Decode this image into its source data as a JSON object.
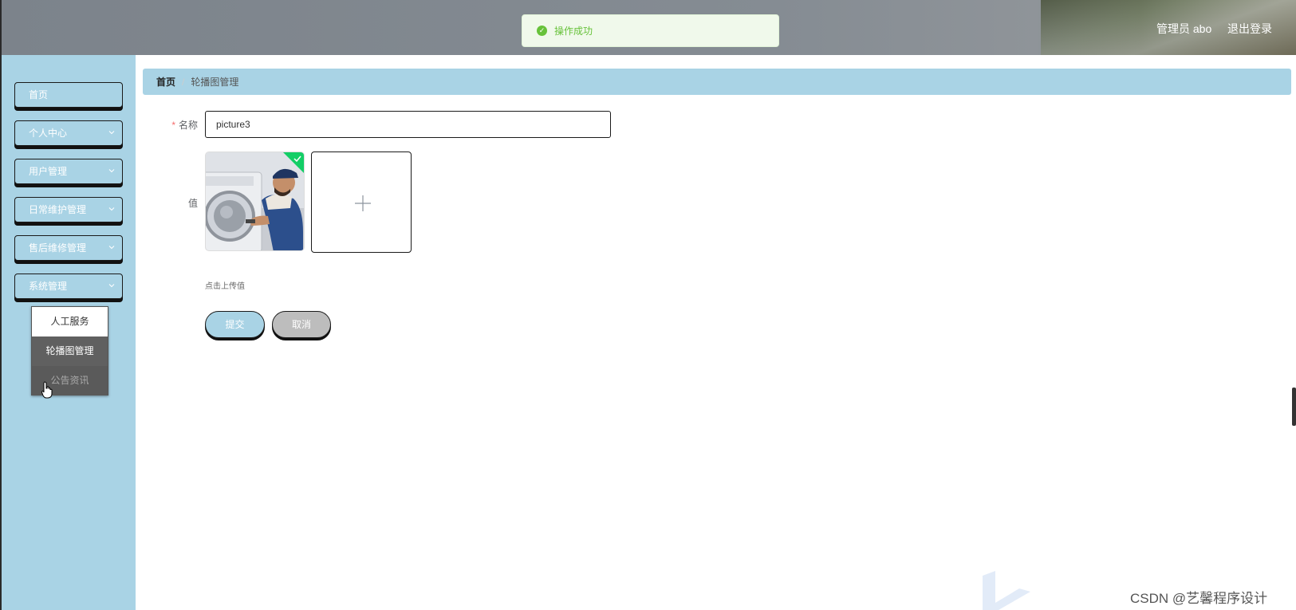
{
  "header": {
    "user_label": "管理员 abo",
    "logout_label": "退出登录"
  },
  "toast": {
    "message": "操作成功",
    "color": "#67c23a"
  },
  "sidebar": {
    "background": "#a9d3e5",
    "items": [
      {
        "label": "首页"
      },
      {
        "label": "个人中心"
      },
      {
        "label": "用户管理"
      },
      {
        "label": "日常维护管理"
      },
      {
        "label": "售后维修管理"
      },
      {
        "label": "系统管理"
      }
    ],
    "submenu": [
      {
        "label": "人工服务"
      },
      {
        "label": "轮播图管理"
      },
      {
        "label": "公告资讯"
      }
    ]
  },
  "breadcrumb": {
    "home": "首页",
    "separator": "/",
    "current": "轮播图管理"
  },
  "form": {
    "name_label": "名称",
    "required_mark": "*",
    "name_value": "picture3",
    "value_label": "值",
    "upload_tip": "点击上传值",
    "submit_label": "提交",
    "cancel_label": "取消"
  },
  "watermark": {
    "text": "CSDN @艺馨程序设计"
  }
}
